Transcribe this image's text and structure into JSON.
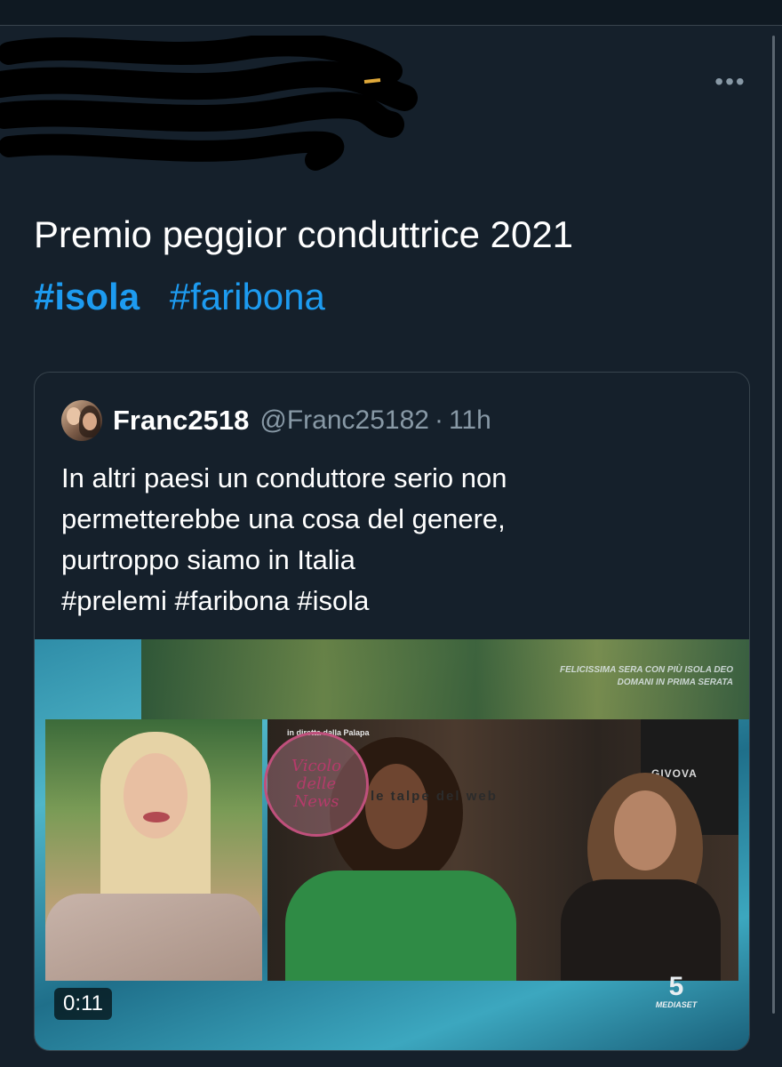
{
  "tweet": {
    "text": "Premio peggior conduttrice 2021",
    "hashtags": [
      "#isola",
      "#faribona"
    ],
    "more_icon": "more-horizontal-icon"
  },
  "quoted_tweet": {
    "display_name": "Franc2518",
    "handle": "@Franc25182",
    "separator": "·",
    "time": "11h",
    "body": "In altri paesi un conduttore serio non\npermetterebbe una cosa del genere,\npurtroppo siamo in Italia\n#prelemi #faribona #isola",
    "media": {
      "type": "video",
      "duration": "0:11",
      "overlay_caption": "FELICISSIMA SERA CON PIÙ ISOLA DEO\nDOMANI IN PRIMA SERATA",
      "panel_label": "in diretta dalla Palapa",
      "background_text": "GIVOVA",
      "channel_number": "5",
      "channel_brand": "MEDIASET",
      "watermarks": [
        "Vicolo delle News",
        "le talpe del web"
      ]
    }
  },
  "colors": {
    "background": "#15202b",
    "accent": "#1d9bf0",
    "muted": "#8899a6",
    "border": "#38444d"
  }
}
